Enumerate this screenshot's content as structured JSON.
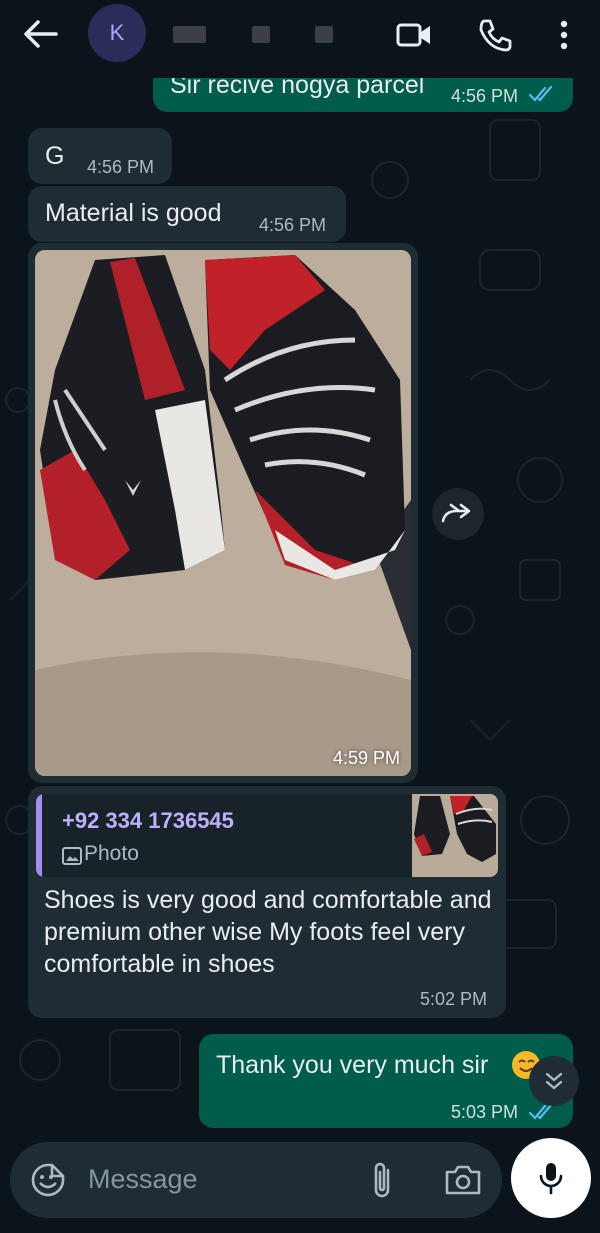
{
  "header": {
    "avatar_letter": "K",
    "contact_name_redacted": true
  },
  "messages": [
    {
      "id": "m1",
      "direction": "out",
      "text": "Sir recive nogya parcel",
      "time": "4:56 PM",
      "status": "read"
    },
    {
      "id": "m2",
      "direction": "in",
      "text": "G",
      "time": "4:56 PM"
    },
    {
      "id": "m3",
      "direction": "in",
      "text": "Material is good",
      "time": "4:56 PM"
    },
    {
      "id": "m4",
      "direction": "in",
      "type": "photo",
      "time": "4:59 PM"
    },
    {
      "id": "m5",
      "direction": "in",
      "quote": {
        "sender": "+92 334 1736545",
        "type_label": "Photo"
      },
      "text": "Shoes is very good and comfortable and premium other wise My  foots feel very comfortable in shoes",
      "time": "5:02 PM"
    },
    {
      "id": "m6",
      "direction": "out",
      "text": "Thank you very much sir",
      "time": "5:03 PM",
      "status": "read"
    }
  ],
  "composer": {
    "placeholder": "Message"
  },
  "colors": {
    "background": "#0b141a",
    "incoming_bubble": "#202c33",
    "outgoing_bubble": "#005c4b",
    "read_ticks": "#53bdeb",
    "quote_accent": "#a58cf0"
  },
  "icons": [
    "back-arrow-icon",
    "video-call-icon",
    "voice-call-icon",
    "more-options-icon",
    "forward-icon",
    "scroll-down-icon",
    "emoji-icon",
    "attach-icon",
    "camera-icon",
    "mic-icon",
    "photo-icon"
  ]
}
